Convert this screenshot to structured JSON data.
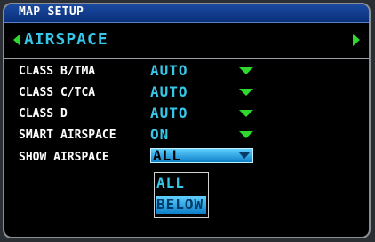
{
  "window": {
    "title": "MAP SETUP"
  },
  "page": {
    "title": "AIRSPACE"
  },
  "settings": [
    {
      "label": "CLASS B/TMA",
      "value": "AUTO"
    },
    {
      "label": "CLASS C/TCA",
      "value": "AUTO"
    },
    {
      "label": "CLASS D",
      "value": "AUTO"
    },
    {
      "label": "SMART AIRSPACE",
      "value": "ON"
    },
    {
      "label": "SHOW AIRSPACE",
      "value": "ALL"
    }
  ],
  "dropdown": {
    "options": [
      "ALL",
      "BELOW"
    ],
    "highlighted": "BELOW"
  },
  "colors": {
    "accent": "#36c6e8",
    "arrow": "#2fd82f",
    "title_bar": "#1b4aa0"
  }
}
